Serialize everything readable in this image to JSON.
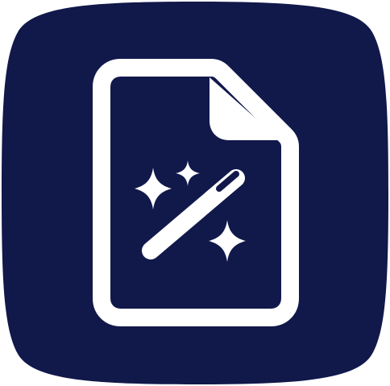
{
  "icon": {
    "name": "magic-document-app-icon",
    "background_color": "#11184A",
    "foreground_color": "#FFFFFF",
    "glyphs": [
      "document-icon",
      "magic-wand-icon",
      "sparkle-icon"
    ]
  }
}
